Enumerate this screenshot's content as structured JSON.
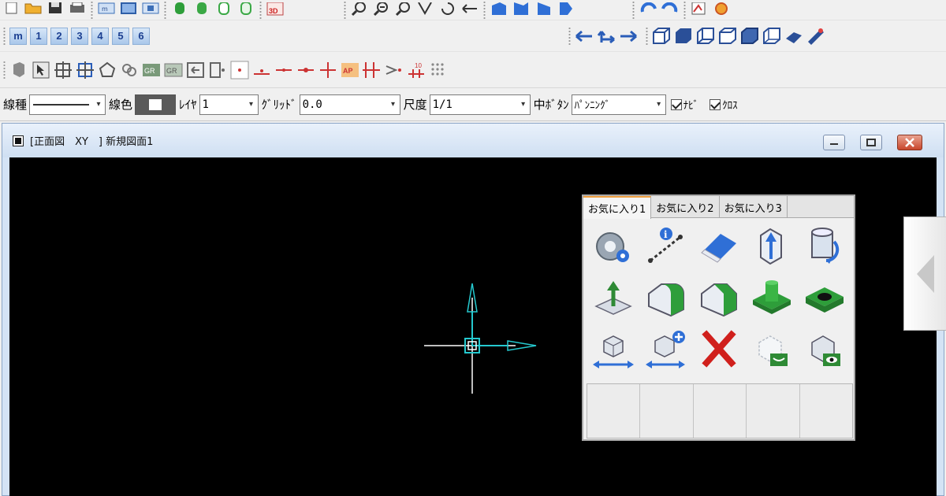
{
  "toolbar": {
    "view_mode_buttons": [
      "m",
      "1",
      "2",
      "3",
      "4",
      "5",
      "6"
    ]
  },
  "properties": {
    "line_type_label": "線種",
    "line_color_label": "線色",
    "layer_label": "ﾚｲﾔ",
    "layer_value": "1",
    "grid_label": "ｸﾞﾘｯﾄﾞ",
    "grid_value": "0.0",
    "scale_label": "尺度",
    "scale_value": "1/1",
    "middle_button_label": "中ﾎﾞﾀﾝ",
    "middle_button_value": "ﾊﾟﾝﾆﾝｸﾞ",
    "navi_label": "ﾅﾋﾞ",
    "navi_checked": true,
    "cross_label": "ｸﾛｽ",
    "cross_checked": true
  },
  "window": {
    "title": "[正面図　XY　] 新規図面1"
  },
  "palette": {
    "tabs": [
      "お気に入り1",
      "お気に入り2",
      "お気に入り3"
    ],
    "active_tab": "お気に入り1",
    "icons": [
      "gear-settings-icon",
      "info-measure-icon",
      "eraser-icon",
      "extrude-arrow-icon",
      "rotate-cylinder-icon",
      "extrude-up-icon",
      "round-fillet-icon",
      "chamfer-icon",
      "boss-icon",
      "hole-icon",
      "move-solid-icon",
      "copy-solid-icon",
      "delete-x-icon",
      "hide-solid-icon",
      "show-solid-icon"
    ]
  },
  "colors": {
    "canvas": "#000000",
    "axis_white": "#ffffff",
    "axis_cyan": "#25c9cf",
    "toolbar_blue": "#2f6fd6",
    "solid_green": "#2e9e3a",
    "delete_red": "#d0201c"
  }
}
